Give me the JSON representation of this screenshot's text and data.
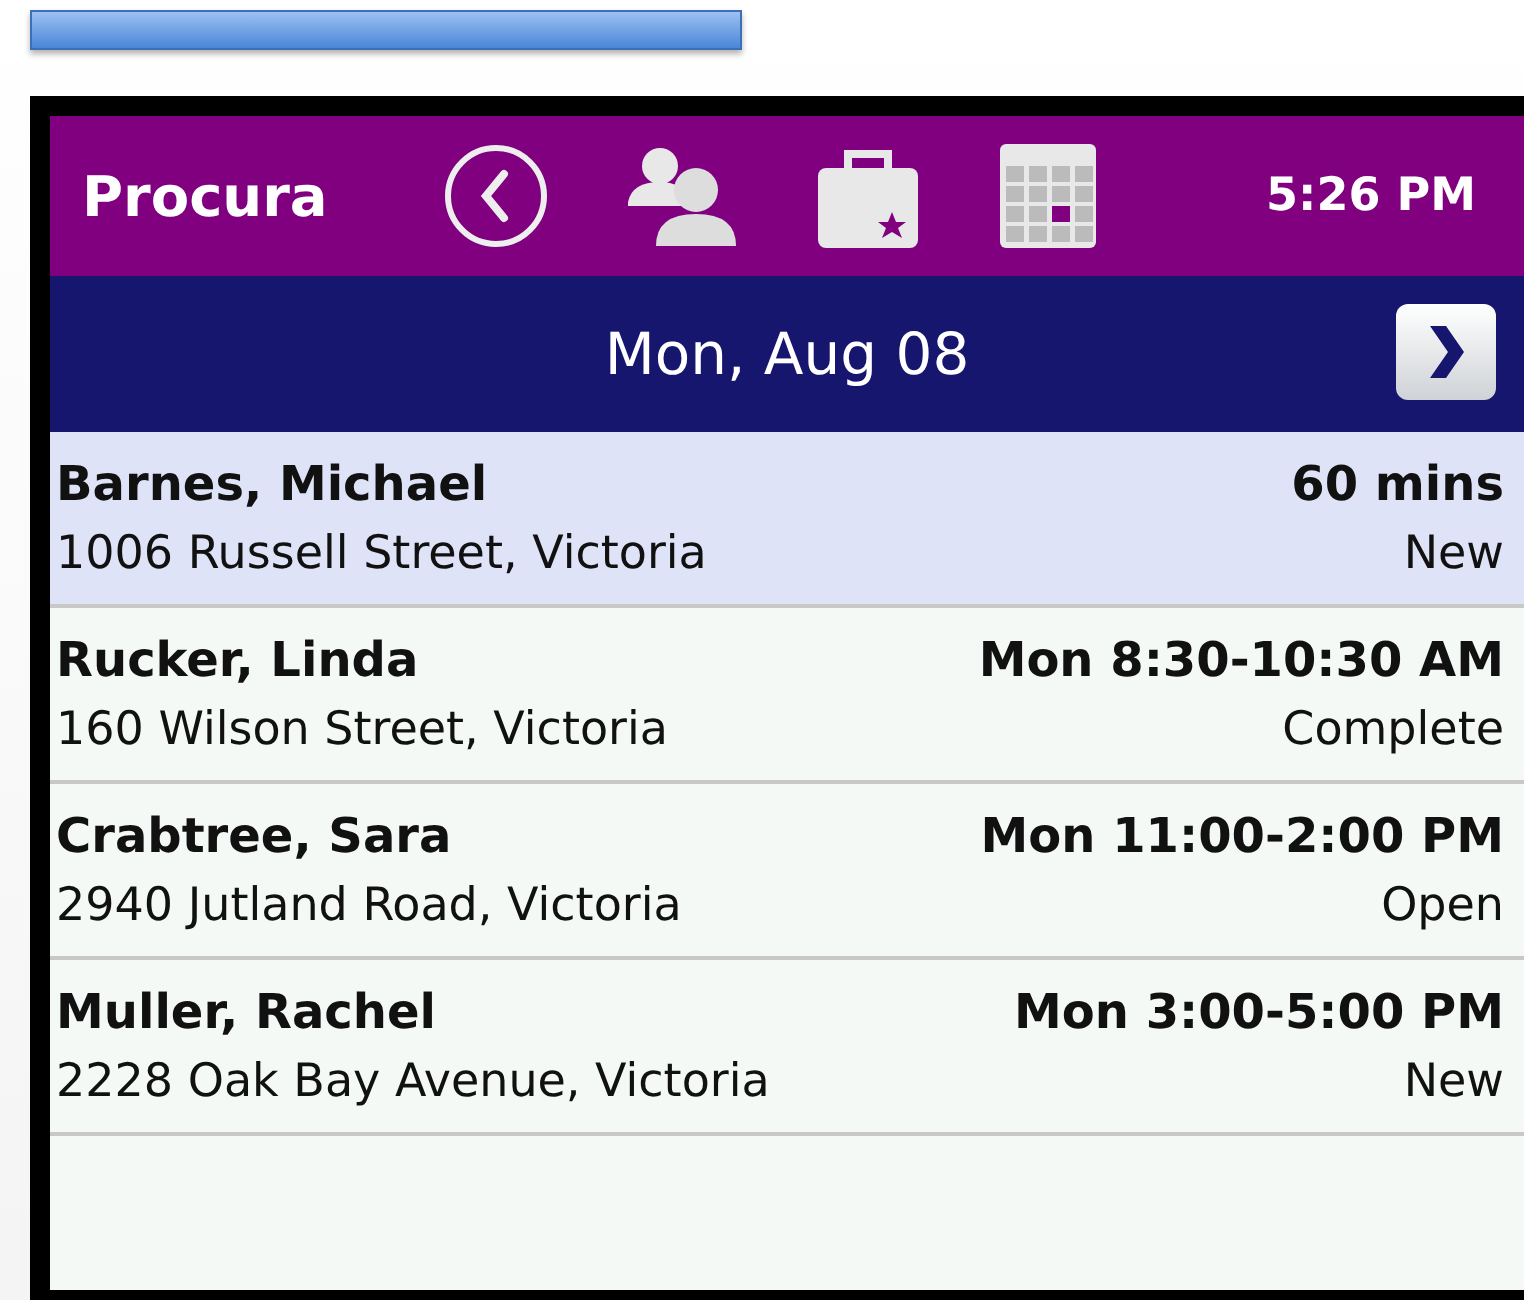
{
  "header": {
    "app_name": "Procura",
    "time": "5:26 PM"
  },
  "date_bar": {
    "date": "Mon, Aug 08"
  },
  "appointments": [
    {
      "name": "Barnes, Michael",
      "time": "60 mins",
      "address": "1006 Russell Street, Victoria",
      "status": "New",
      "selected": true
    },
    {
      "name": "Rucker, Linda",
      "time": "Mon 8:30-10:30 AM",
      "address": "160 Wilson Street, Victoria",
      "status": "Complete",
      "selected": false
    },
    {
      "name": "Crabtree, Sara",
      "time": "Mon 11:00-2:00 PM",
      "address": "2940 Jutland Road, Victoria",
      "status": "Open",
      "selected": false
    },
    {
      "name": "Muller, Rachel",
      "time": "Mon 3:00-5:00 PM",
      "address": "2228 Oak Bay Avenue, Victoria",
      "status": "New",
      "selected": false
    }
  ]
}
